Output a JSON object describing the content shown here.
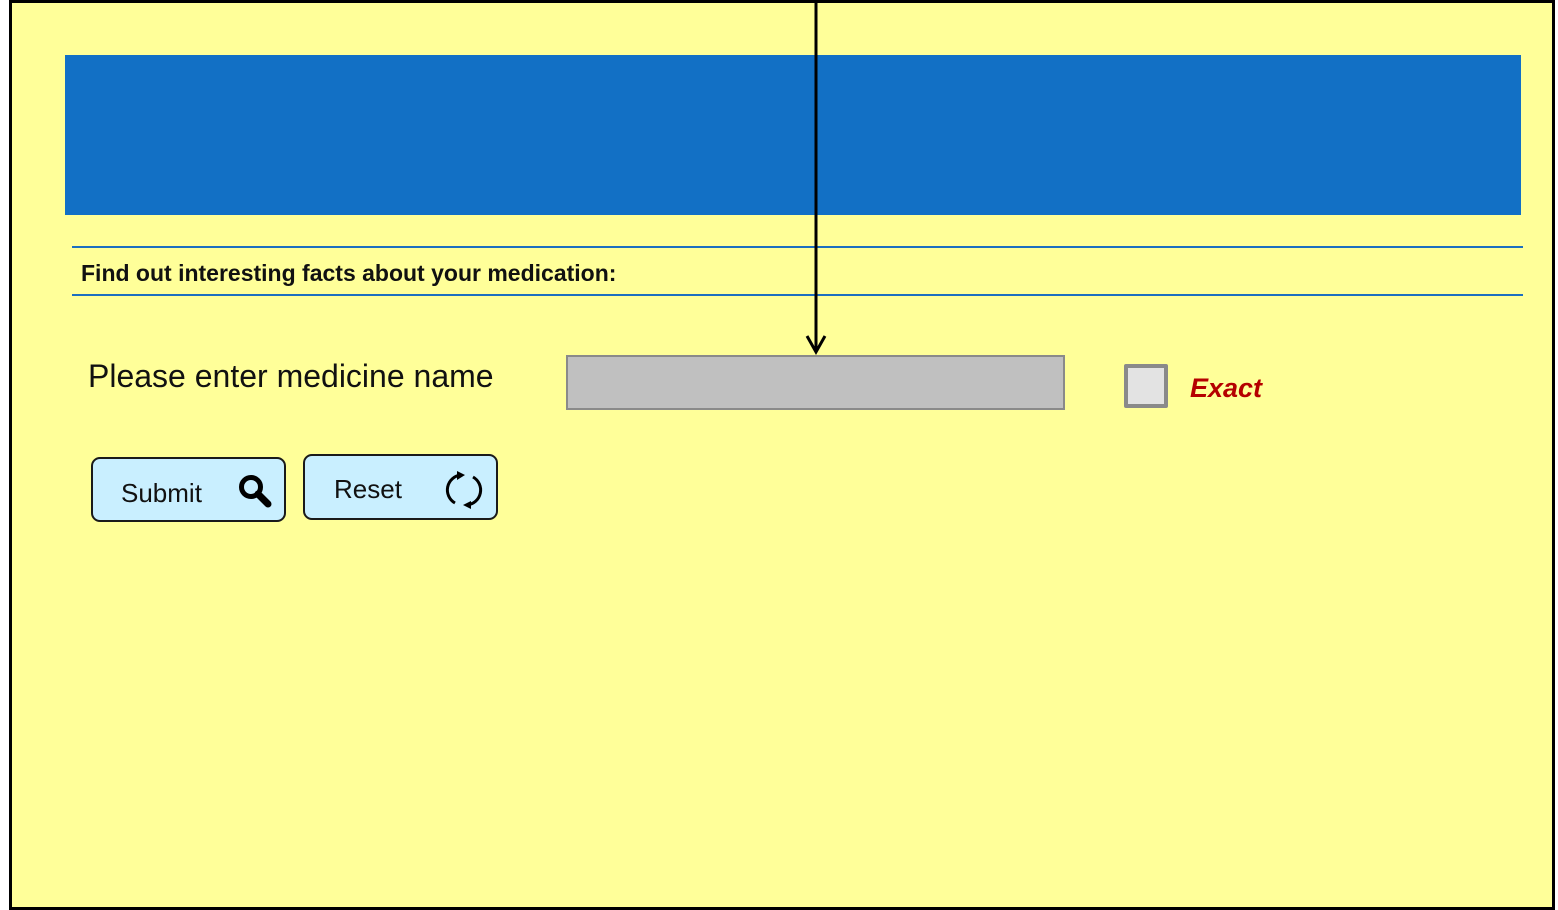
{
  "header": {
    "banner_color": "#1270c5"
  },
  "search": {
    "heading": "Find out interesting facts about your medication:",
    "field_label": "Please enter medicine name",
    "input_value": "",
    "input_placeholder": "",
    "exact_label": "Exact",
    "exact_checked": false
  },
  "actions": {
    "submit_label": "Submit",
    "submit_icon": "search-icon",
    "reset_label": "Reset",
    "reset_icon": "refresh-icon"
  },
  "colors": {
    "page_background": "#ffff99",
    "button_background": "#c9efff",
    "exact_label": "#b50000",
    "rule": "#1c6fc0"
  }
}
